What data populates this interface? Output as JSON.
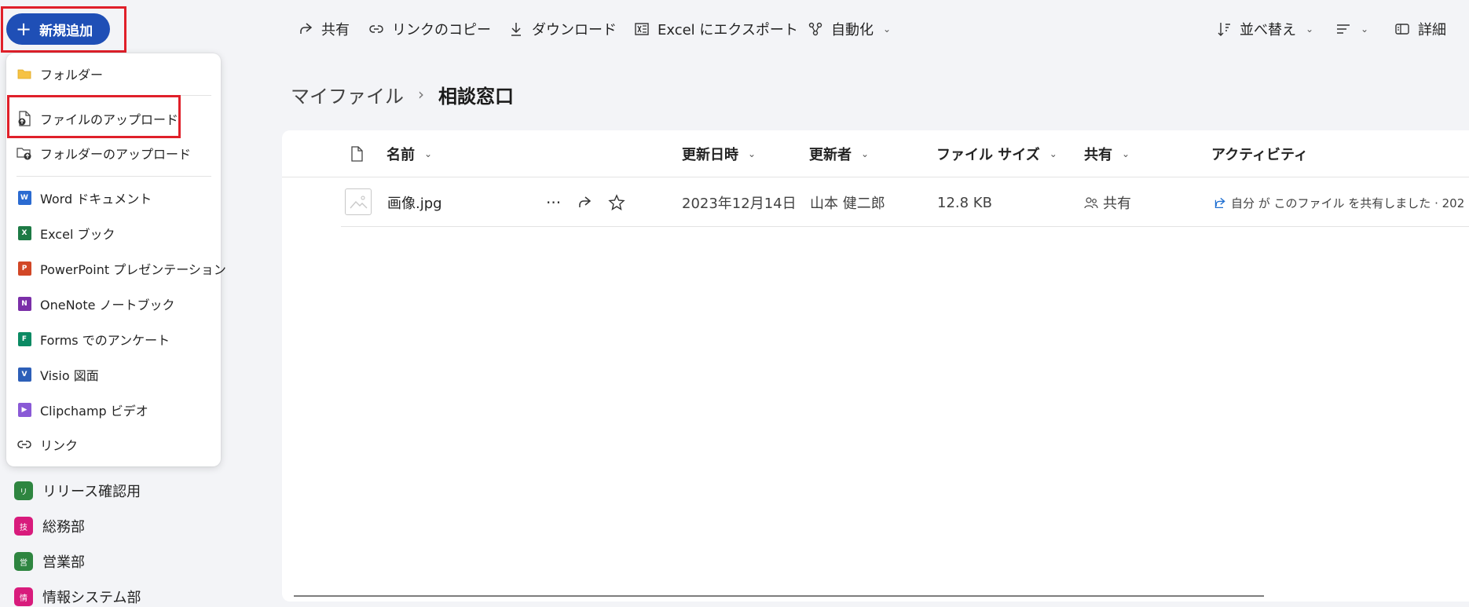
{
  "new_button": {
    "label": "新規追加"
  },
  "toolbar": {
    "share": "共有",
    "copy_link": "リンクのコピー",
    "download": "ダウンロード",
    "export_excel": "Excel にエクスポート",
    "automate": "自動化",
    "sort": "並べ替え",
    "details": "詳細"
  },
  "breadcrumb": {
    "root": "マイファイル",
    "separator": "›",
    "current": "相談窓口"
  },
  "columns": {
    "name": "名前",
    "modified": "更新日時",
    "modified_by": "更新者",
    "file_size": "ファイル サイズ",
    "sharing": "共有",
    "activity": "アクティビティ"
  },
  "files": [
    {
      "name": "画像.jpg",
      "modified": "2023年12月14日",
      "modified_by": "山本 健二郎",
      "size": "12.8 KB",
      "sharing": "共有",
      "activity": "自分 が このファイル を共有しました · 202"
    }
  ],
  "menu": {
    "folder": "フォルダー",
    "file_upload": "ファイルのアップロード",
    "folder_upload": "フォルダーのアップロード",
    "word": "Word ドキュメント",
    "excel": "Excel ブック",
    "powerpoint": "PowerPoint プレゼンテーション",
    "onenote": "OneNote ノートブック",
    "forms": "Forms でのアンケート",
    "visio": "Visio 図面",
    "clipchamp": "Clipchamp ビデオ",
    "link": "リンク"
  },
  "nav": [
    {
      "label": "リリース確認用",
      "avatar": "リ",
      "color": "#2e8540"
    },
    {
      "label": "総務部",
      "avatar": "技",
      "color": "#d81b7c"
    },
    {
      "label": "営業部",
      "avatar": "営",
      "color": "#2e8540"
    },
    {
      "label": "情報システム部",
      "avatar": "情",
      "color": "#d81b7c"
    }
  ],
  "colors": {
    "accent": "#1f4fb6",
    "highlight": "#e0202a"
  }
}
